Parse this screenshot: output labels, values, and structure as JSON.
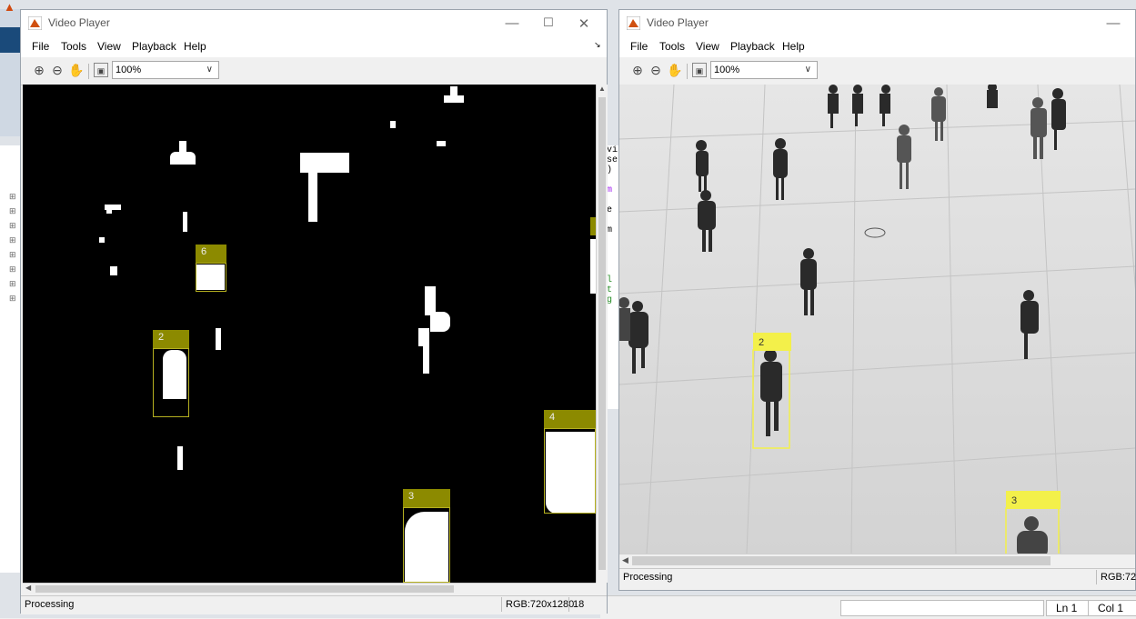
{
  "left_player": {
    "title": "Video Player",
    "menu": [
      "File",
      "Tools",
      "View",
      "Playback",
      "Help"
    ],
    "zoom": "100%",
    "status": "Processing",
    "format": "RGB:720x1280",
    "frame": "18",
    "boxes": [
      {
        "label": "6"
      },
      {
        "label": "2"
      },
      {
        "label": "4"
      },
      {
        "label": "3"
      }
    ]
  },
  "right_player": {
    "title": "Video Player",
    "menu": [
      "File",
      "Tools",
      "View",
      "Playback",
      "Help"
    ],
    "zoom": "100%",
    "status": "Processing",
    "format": "RGB:72",
    "boxes": [
      {
        "label": "2"
      },
      {
        "label": "3"
      }
    ]
  },
  "matlab": {
    "ln": "Ln  1",
    "col": "Col  1",
    "code_lines": [
      "rivi",
      "lase",
      "r()",
      "eo",
      "lum",
      "",
      "oje",
      "e,",
      "s(m",
      "",
      "",
      "l,",
      "",
      "xel",
      "ect",
      "fig",
      "e"
    ]
  },
  "colors": {
    "mask_box": "#b5b020",
    "mask_label": "#8c8a00",
    "video_box": "#f3f04a"
  }
}
